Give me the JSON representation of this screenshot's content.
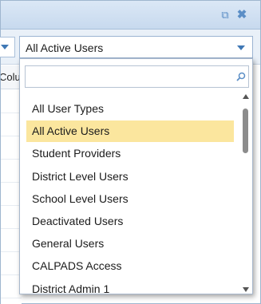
{
  "window": {
    "restore_icon": "popout-icon",
    "close_icon": "close-icon",
    "accent_color": "#3f78b5"
  },
  "grid": {
    "column_header_fragment": "Colun"
  },
  "user_type_combo": {
    "value": "All Active Users"
  },
  "dropdown": {
    "search": {
      "value": "",
      "placeholder": ""
    },
    "items": [
      {
        "label": "All User Types",
        "selected": false
      },
      {
        "label": "All Active Users",
        "selected": true
      },
      {
        "label": "Student Providers",
        "selected": false
      },
      {
        "label": "District Level Users",
        "selected": false
      },
      {
        "label": "School Level Users",
        "selected": false
      },
      {
        "label": "Deactivated Users",
        "selected": false
      },
      {
        "label": "General Users",
        "selected": false
      },
      {
        "label": "CALPADS Access",
        "selected": false
      },
      {
        "label": "District Admin 1",
        "selected": false
      }
    ],
    "highlight_color": "#fbe69e"
  }
}
